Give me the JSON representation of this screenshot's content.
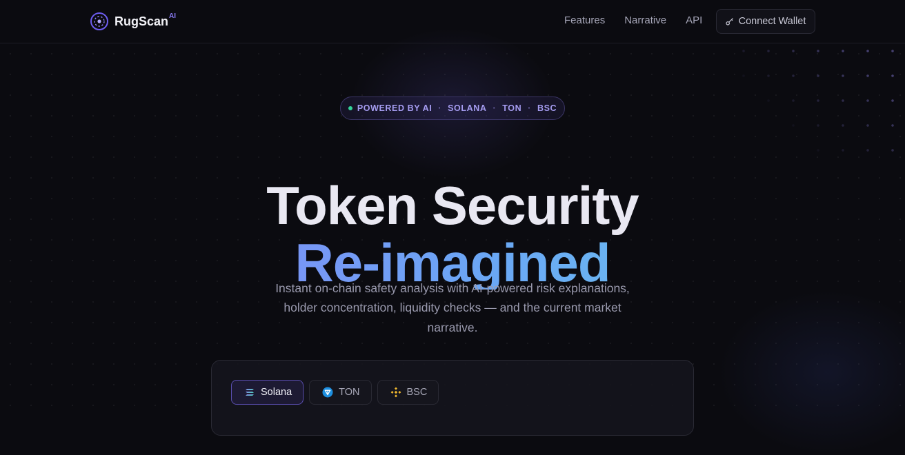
{
  "brand": {
    "name": "RugScan",
    "sup": "AI",
    "icon": "radar-logo-icon"
  },
  "nav": {
    "links": [
      {
        "label": "Features"
      },
      {
        "label": "Narrative"
      },
      {
        "label": "API"
      }
    ],
    "wallet_button": {
      "label": "Connect Wallet",
      "icon": "key-icon"
    }
  },
  "hero": {
    "badge": {
      "items": [
        "POWERED BY AI",
        "SOLANA",
        "TON",
        "BSC"
      ],
      "separator": "·",
      "dot_color": "#34d399"
    },
    "title_line1": "Token Security",
    "title_line2": "Re-imagined",
    "subtitle": "Instant on-chain safety analysis with AI-powered risk explanations, holder concentration, liquidity checks — and the current market narrative."
  },
  "scanner": {
    "chains": [
      {
        "label": "Solana",
        "icon": "solana-icon",
        "active": true
      },
      {
        "label": "TON",
        "icon": "ton-icon",
        "active": false
      },
      {
        "label": "BSC",
        "icon": "bnb-icon",
        "active": false
      }
    ]
  },
  "colors": {
    "accent": "#8b7cf6",
    "gradient_start": "#8b7cf6",
    "gradient_end": "#6ad0e8",
    "background": "#0b0b10"
  }
}
